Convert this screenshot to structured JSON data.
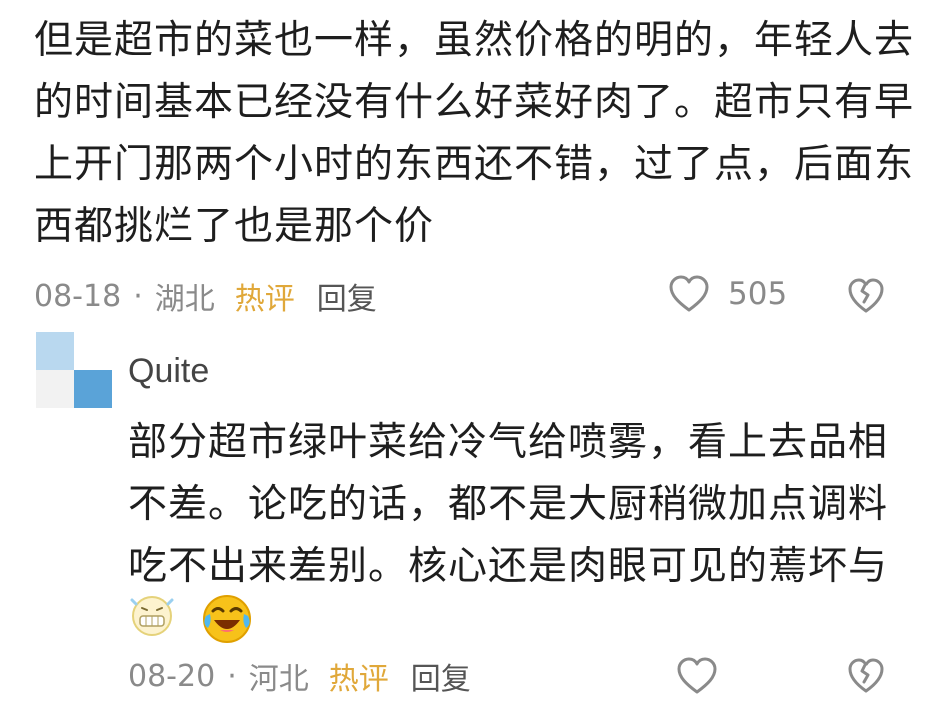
{
  "main_comment": {
    "text": "但是超市的菜也一样，虽然价格的明的，年轻人去的时间基本已经没有什么好菜好肉了。超市只有早上开门那两个小时的东西还不错，过了点，后面东西都挑烂了也是那个价",
    "date": "08-18",
    "separator": "·",
    "location": "湖北",
    "badge": "热评",
    "reply_label": "回复",
    "like_count": "505",
    "like_icon": "heart-outline-icon",
    "dislike_icon": "broken-heart-icon"
  },
  "reply": {
    "username": "Quite",
    "text": "部分超市绿叶菜给冷气给喷雾，看上去品相不差。论吃的话，都不是大厨稍微加点调料吃不出来差别。核心还是肉眼可见的蔫坏与",
    "emojis": [
      "grimace-emoji",
      "laughing-crying-emoji"
    ],
    "date": "08-20",
    "separator": "·",
    "location": "河北",
    "badge": "热评",
    "reply_label": "回复",
    "like_icon": "heart-outline-icon",
    "dislike_icon": "broken-heart-icon"
  },
  "colors": {
    "text": "#1e1e1e",
    "meta": "#8a8a8a",
    "hot_badge": "#e0a83a",
    "avatar_blue": "#5aa3d8"
  }
}
